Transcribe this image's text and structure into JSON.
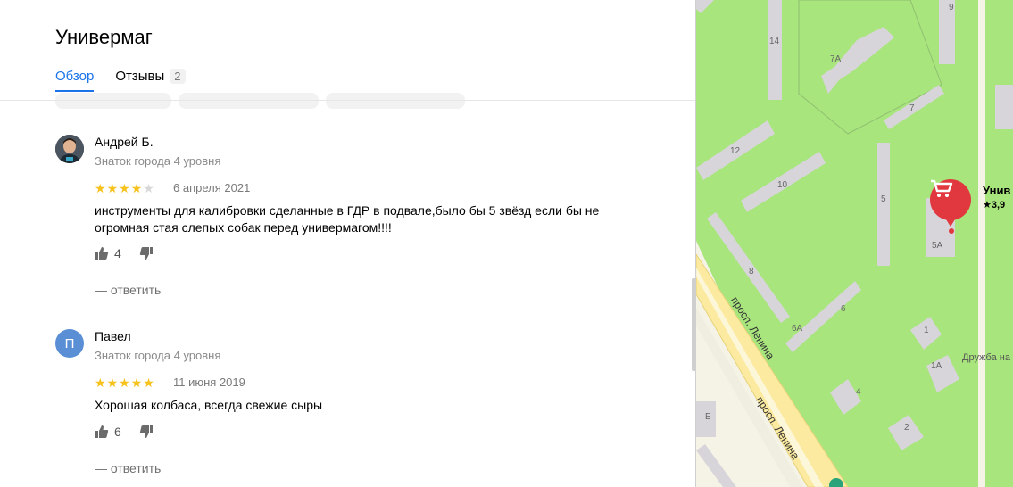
{
  "header": {
    "title": "Универмаг"
  },
  "tabs": [
    {
      "label": "Обзор",
      "active": true
    },
    {
      "label": "Отзывы",
      "count": "2",
      "active": false
    }
  ],
  "reviews": [
    {
      "author": "Андрей Б.",
      "level": "Знаток города 4 уровня",
      "rating": 4,
      "date": "6 апреля 2021",
      "text": "инструменты для калибровки сделанные в ГДР в подвале,было бы 5 звёзд если бы не огромная стая слепых собак перед универмагом!!!!",
      "likes": "4",
      "reply_label": "— ответить"
    },
    {
      "author": "Павел",
      "avatar_letter": "П",
      "level": "Знаток города 4 уровня",
      "rating": 5,
      "date": "11 июня 2019",
      "text": "Хорошая колбаса, всегда свежие сыры",
      "likes": "6",
      "reply_label": "— ответить"
    }
  ],
  "map": {
    "poi_name": "Унив",
    "poi_rating": "3,9",
    "street": "просп. Ленина",
    "nearby_label": "Дружба на",
    "building_labels": [
      "9",
      "14",
      "7А",
      "7",
      "12",
      "10",
      "5",
      "5А",
      "8",
      "6",
      "6А",
      "1",
      "1А",
      "4",
      "2",
      "Б"
    ]
  },
  "colors": {
    "accent": "#1a73e8",
    "star": "#f6c21c",
    "poi": "#e0383e",
    "map_grass": "#a8e57d",
    "building": "#d7d5d9"
  }
}
